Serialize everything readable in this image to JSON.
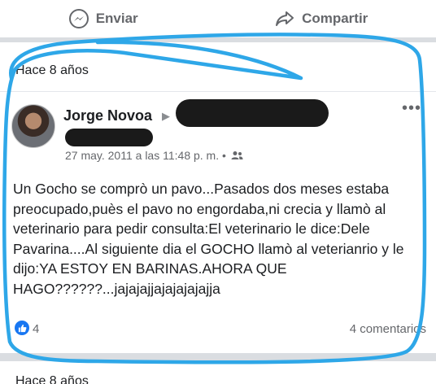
{
  "actions": {
    "send_label": "Enviar",
    "share_label": "Compartir"
  },
  "memory": {
    "label": "Hace 8 años"
  },
  "post": {
    "author": "Jorge Novoa",
    "timestamp": "27 may. 2011 a las 11:48 p. m. •",
    "text": "Un Gocho se comprò un pavo...Pasados dos meses estaba preocupado,puès el pavo no engordaba,ni crecia y llamò al veterinario para pedir consulta:El veterinario le dice:Dele Pavarina....Al siguiente dia el GOCHO llamò al veterianrio y le dijo:YA ESTOY EN BARINAS.AHORA QUE HAGO??????...jajajajjajajajajajja",
    "likes": "4",
    "comments": "4 comentarios",
    "audience_icon": "friends-icon",
    "more_icon": "more-options-icon"
  },
  "next_memory": {
    "label": "Hace 8 años"
  },
  "colors": {
    "facebook_blue": "#1877f2",
    "annotation_stroke": "#2ea7e8",
    "secondary_text": "#65676b",
    "redaction": "#1a1a1a"
  }
}
